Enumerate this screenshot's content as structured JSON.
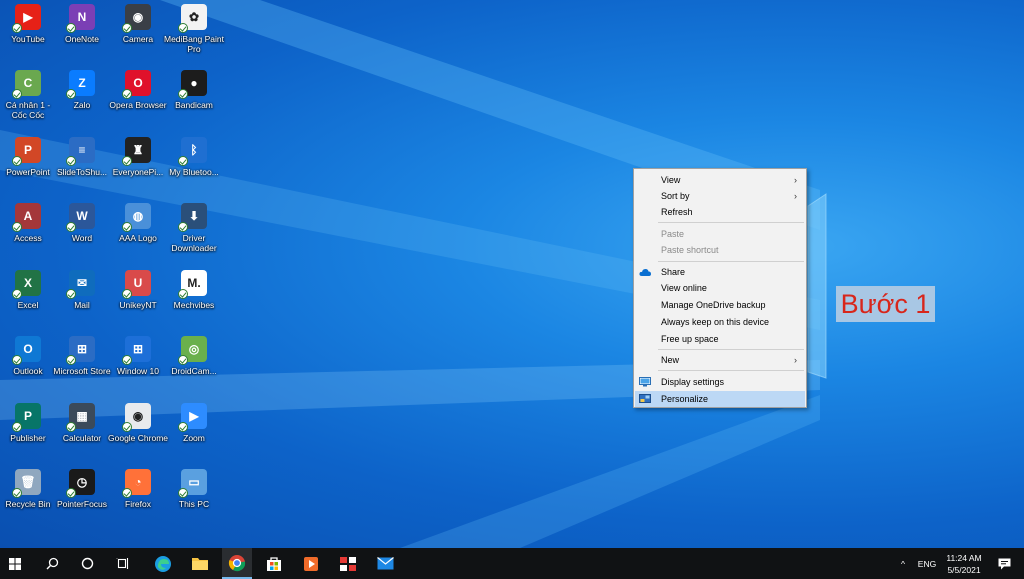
{
  "desktop": {
    "icons": [
      {
        "label": "YouTube",
        "symbol": "▶",
        "color": "#e62117",
        "name": "youtube-icon"
      },
      {
        "label": "OneNote",
        "symbol": "N",
        "color": "#7b3fb5",
        "name": "onenote-icon"
      },
      {
        "label": "Camera",
        "symbol": "◉",
        "color": "#3a3f47",
        "name": "camera-icon"
      },
      {
        "label": "MediBang Paint Pro",
        "symbol": "✿",
        "color": "#f3f3f3",
        "name": "medibang-icon"
      },
      {
        "label": "Cá nhân 1 - Cốc Cốc",
        "symbol": "C",
        "color": "#6aa84f",
        "name": "coccoc-icon"
      },
      {
        "label": "Zalo",
        "symbol": "Z",
        "color": "#0a7cff",
        "name": "zalo-icon"
      },
      {
        "label": "Opera Browser",
        "symbol": "O",
        "color": "#e0112b",
        "name": "opera-icon"
      },
      {
        "label": "Bandicam",
        "symbol": "●",
        "color": "#1c1c1c",
        "name": "bandicam-icon"
      },
      {
        "label": "PowerPoint",
        "symbol": "P",
        "color": "#d24726",
        "name": "powerpoint-icon"
      },
      {
        "label": "SlideToShu...",
        "symbol": "≡",
        "color": "#2b6cc4",
        "name": "slidetoshutdown-icon"
      },
      {
        "label": "EveryonePi...",
        "symbol": "♜",
        "color": "#222222",
        "name": "everyonepiano-icon"
      },
      {
        "label": "My Bluetoo...",
        "symbol": "ᛒ",
        "color": "#1f6fd1",
        "name": "bluetooth-icon"
      },
      {
        "label": "Access",
        "symbol": "A",
        "color": "#a4373a",
        "name": "access-icon"
      },
      {
        "label": "Word",
        "symbol": "W",
        "color": "#2b579a",
        "name": "word-icon"
      },
      {
        "label": "AAA Logo",
        "symbol": "◍",
        "color": "#4a90d9",
        "name": "aaalogo-icon"
      },
      {
        "label": "Driver Downloader",
        "symbol": "⬇",
        "color": "#2a4f7a",
        "name": "driverdownloader-icon"
      },
      {
        "label": "Excel",
        "symbol": "X",
        "color": "#217346",
        "name": "excel-icon"
      },
      {
        "label": "Mail",
        "symbol": "✉",
        "color": "#0f6cbd",
        "name": "mail-icon"
      },
      {
        "label": "UnikeyNT",
        "symbol": "U",
        "color": "#d94a4a",
        "name": "unikey-icon"
      },
      {
        "label": "Mechvibes",
        "symbol": "M.",
        "color": "#ffffff",
        "name": "mechvibes-icon"
      },
      {
        "label": "Outlook",
        "symbol": "O",
        "color": "#0f78d4",
        "name": "outlook-icon"
      },
      {
        "label": "Microsoft Store",
        "symbol": "⊞",
        "color": "#2b6cc4",
        "name": "store-icon"
      },
      {
        "label": "Window 10",
        "symbol": "⊞",
        "color": "#1d6fd8",
        "name": "window10-icon"
      },
      {
        "label": "DroidCam...",
        "symbol": "◎",
        "color": "#6ab04c",
        "name": "droidcam-icon"
      },
      {
        "label": "Publisher",
        "symbol": "P",
        "color": "#077568",
        "name": "publisher-icon"
      },
      {
        "label": "Calculator",
        "symbol": "▦",
        "color": "#3b4a5a",
        "name": "calculator-icon"
      },
      {
        "label": "Google Chrome",
        "symbol": "◉",
        "color": "#e8eaed",
        "name": "chrome-icon"
      },
      {
        "label": "Zoom",
        "symbol": "▶",
        "color": "#2d8cff",
        "name": "zoom-icon"
      },
      {
        "label": "Recycle Bin",
        "symbol": "🗑",
        "color": "#8fa7bf",
        "name": "recyclebin-icon"
      },
      {
        "label": "PointerFocus",
        "symbol": "◷",
        "color": "#1a1a1a",
        "name": "pointerfocus-icon"
      },
      {
        "label": "Firefox",
        "symbol": "◔",
        "color": "#ff7139",
        "name": "firefox-icon"
      },
      {
        "label": "This PC",
        "symbol": "▭",
        "color": "#5aa0e0",
        "name": "thispc-icon"
      }
    ]
  },
  "context_menu": {
    "items": [
      {
        "label": "View",
        "submenu": true
      },
      {
        "label": "Sort by",
        "submenu": true
      },
      {
        "label": "Refresh"
      },
      {
        "label": "Paste",
        "disabled": true
      },
      {
        "label": "Paste shortcut",
        "disabled": true
      },
      {
        "label": "Share"
      },
      {
        "label": "View online"
      },
      {
        "label": "Manage OneDrive backup"
      },
      {
        "label": "Always keep on this device"
      },
      {
        "label": "Free up space"
      },
      {
        "label": "New",
        "submenu": true
      },
      {
        "label": "Display settings"
      },
      {
        "label": "Personalize",
        "highlighted": true
      }
    ],
    "submenu_arrow": "›"
  },
  "annotation": {
    "text": "Bước 1",
    "color": "#d8261b"
  },
  "taskbar": {
    "tray": {
      "chevron": "^",
      "language": "ENG",
      "time": "11:24 AM",
      "date": "5/5/2021"
    }
  }
}
